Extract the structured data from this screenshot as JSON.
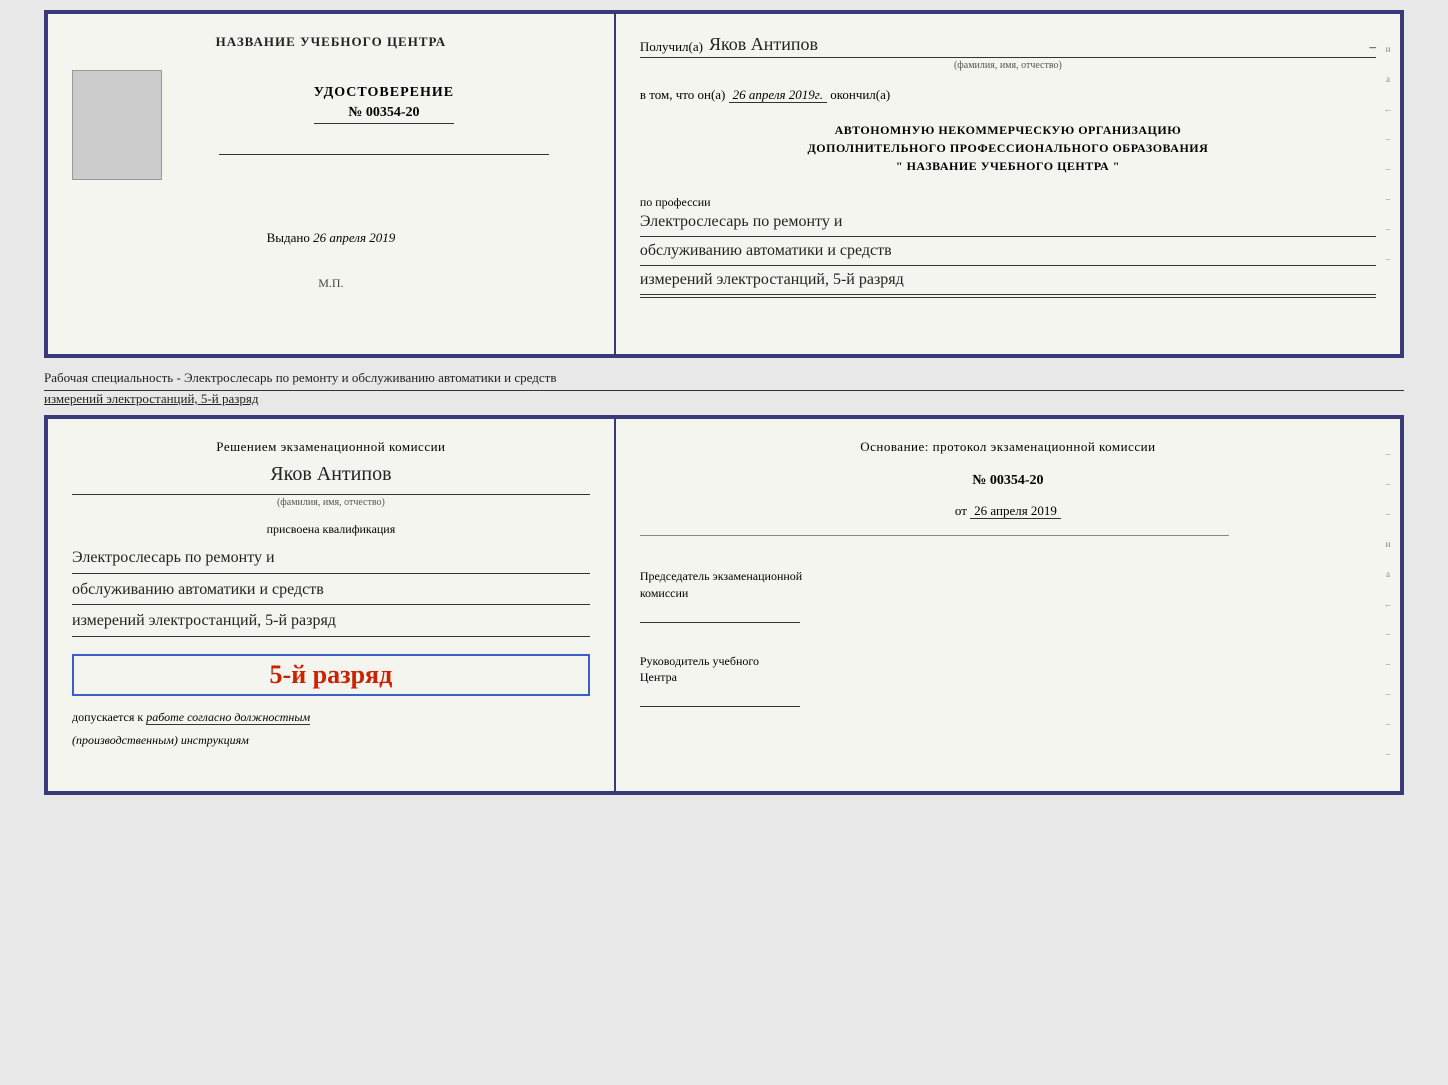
{
  "top": {
    "left": {
      "center_title": "НАЗВАНИЕ УЧЕБНОГО ЦЕНТРА",
      "cert_title": "УДОСТОВЕРЕНИЕ",
      "cert_number": "№ 00354-20",
      "issued_label": "Выдано",
      "issued_date": "26 апреля 2019",
      "stamp": "М.П."
    },
    "right": {
      "recipient_label": "Получил(а)",
      "recipient_name": "Яков Антипов",
      "recipient_subtitle": "(фамилия, имя, отчество)",
      "date_label": "в том, что он(а)",
      "date_value": "26 апреля 2019г.",
      "date_suffix": "окончил(а)",
      "org_line1": "АВТОНОМНУЮ НЕКОММЕРЧЕСКУЮ ОРГАНИЗАЦИЮ",
      "org_line2": "ДОПОЛНИТЕЛЬНОГО ПРОФЕССИОНАЛЬНОГО ОБРАЗОВАНИЯ",
      "org_line3": "\"   НАЗВАНИЕ УЧЕБНОГО ЦЕНТРА   \"",
      "profession_label": "по профессии",
      "profession_line1": "Электрослесарь по ремонту и",
      "profession_line2": "обслуживанию автоматики и средств",
      "profession_line3": "измерений электростанций, 5-й разряд"
    }
  },
  "middle_text": "Рабочая специальность - Электрослесарь по ремонту и обслуживанию автоматики и средств",
  "middle_text2": "измерений электростанций, 5-й разряд",
  "bottom": {
    "left": {
      "commission_title": "Решением экзаменационной комиссии",
      "person_name": "Яков Антипов",
      "person_subtitle": "(фамилия, имя, отчество)",
      "qualification_label": "присвоена квалификация",
      "qual_line1": "Электрослесарь по ремонту и",
      "qual_line2": "обслуживанию автоматики и средств",
      "qual_line3": "измерений электростанций, 5-й разряд",
      "grade": "5-й разряд",
      "допуск_label": "допускается к",
      "допуск_text": "работе согласно должностным",
      "допуск_text2": "(производственным) инструкциям"
    },
    "right": {
      "basis_label": "Основание: протокол экзаменационной комиссии",
      "protocol_number": "№ 00354-20",
      "date_label": "от",
      "date_value": "26 апреля 2019",
      "chairman_label1": "Председатель экзаменационной",
      "chairman_label2": "комиссии",
      "director_label1": "Руководитель учебного",
      "director_label2": "Центра"
    }
  },
  "side_chars": [
    "и",
    "а",
    "←",
    "–",
    "–",
    "–",
    "–",
    "–"
  ]
}
